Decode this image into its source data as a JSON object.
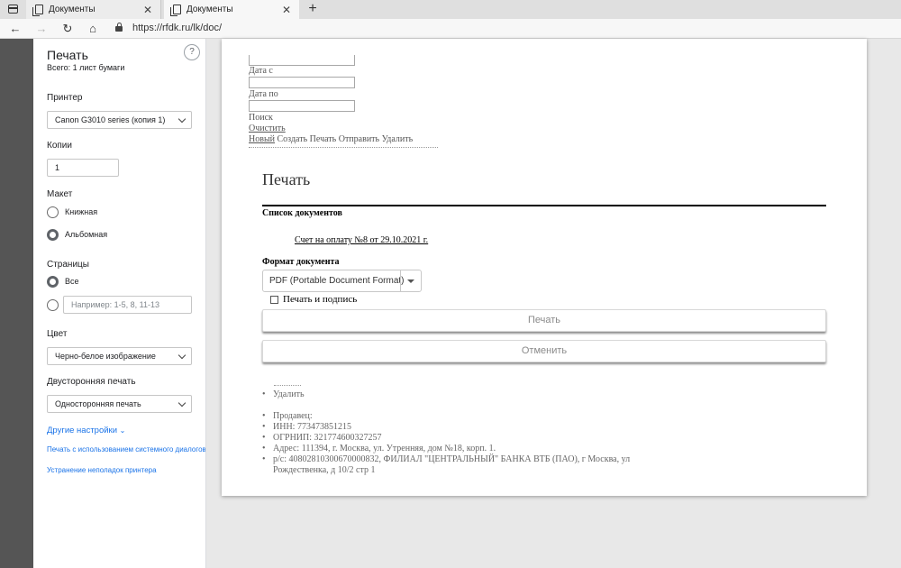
{
  "browser": {
    "tabs": [
      {
        "title": "Документы",
        "active": false
      },
      {
        "title": "Документы",
        "active": true
      }
    ],
    "url": "https://rfdk.ru/lk/doc/"
  },
  "print_panel": {
    "title": "Печать",
    "subtitle": "Всего: 1 лист бумаги",
    "help_label": "?",
    "printer": {
      "label": "Принтер",
      "value": "Canon G3010 series (копия 1)"
    },
    "copies": {
      "label": "Копии",
      "value": "1"
    },
    "layout": {
      "label": "Макет",
      "options": [
        "Книжная",
        "Альбомная"
      ],
      "selected": "Альбомная"
    },
    "pages": {
      "label": "Страницы",
      "option_all": "Все",
      "custom_placeholder": "Например: 1-5, 8, 11-13",
      "selected": "Все"
    },
    "color": {
      "label": "Цвет",
      "value": "Черно-белое изображение"
    },
    "duplex": {
      "label": "Двусторонняя печать",
      "value": "Односторонняя печать"
    },
    "more_settings": "Другие настройки",
    "system_dialog": "Печать с использованием системного диалогового окна",
    "troubleshoot": "Устранение неполадок принтера"
  },
  "preview": {
    "filter": {
      "date_from_label": "Дата с",
      "date_to_label": "Дата по",
      "search": "Поиск",
      "clear": "Очистить",
      "actions": [
        "Новый",
        "Создать",
        "Печать",
        "Отправить",
        "Удалить"
      ]
    },
    "modal": {
      "title": "Печать",
      "doc_list_label": "Список документов",
      "document_link": "Счет на оплату №8 от 29.10.2021 г.",
      "format_label": "Формат документа",
      "format_value": "PDF (Portable Document Format)",
      "stamp_checkbox": "Печать и подпись",
      "stamp_checked": false,
      "print_button": "Печать",
      "cancel_button": "Отменить"
    },
    "list_items": [
      "Удалить"
    ],
    "seller": {
      "seller": "Продавец: ",
      "inn": "ИНН: 773473851215",
      "ogrnip": "ОГРНИП: 321774600327257",
      "address": "Адрес: 111394, г. Москва, ул. Утренняя, дом №18, корп. 1.",
      "account_line1": "р/с: 40802810300670000832, ФИЛИАЛ \"ЦЕНТРАЛЬНЫЙ\" БАНКА ВТБ (ПАО), г Москва, ул",
      "account_line2": "Рождественка, д 10/2 стр 1"
    }
  }
}
